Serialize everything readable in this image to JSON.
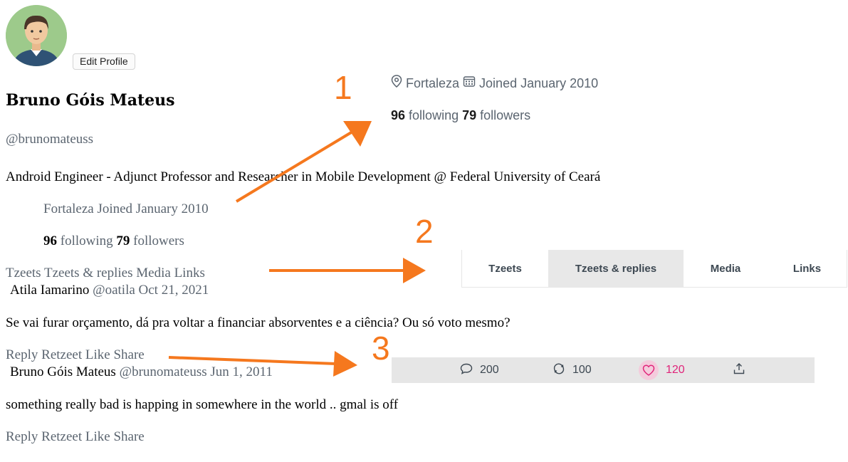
{
  "profile": {
    "edit_button": "Edit Profile",
    "name": "Bruno Góis Mateus",
    "handle": "@brunomateuss",
    "bio": "Android Engineer - Adjunct Professor and Researcher in Mobile Development @ Federal University of Ceará",
    "location": "Fortaleza",
    "joined": "Joined January 2010",
    "following_count": "96",
    "following_label": "following",
    "followers_count": "79",
    "followers_label": "followers"
  },
  "tabs": [
    "Tzeets",
    "Tzeets & replies",
    "Media",
    "Links"
  ],
  "active_tab": "Tzeets & replies",
  "tweets": [
    {
      "author": "Atila Iamarino",
      "handle": "@oatila",
      "date": "Oct 21, 2021",
      "text": "Se vai furar orçamento, dá pra voltar a financiar absorventes e a ciência? Ou só voto mesmo?",
      "actions": [
        "Reply",
        "Retzeet",
        "Like",
        "Share"
      ]
    },
    {
      "author": "Bruno Góis Mateus",
      "handle": "@brunomateuss",
      "date": "Jun 1, 2011",
      "text": "something really bad is happing in somewhere in the world .. gmal is off",
      "actions": [
        "Reply",
        "Retzeet",
        "Like",
        "Share"
      ]
    }
  ],
  "callouts": {
    "labels": [
      "1",
      "2",
      "3"
    ],
    "color": "#f5781e",
    "panel1": {
      "location": "Fortaleza",
      "joined": "Joined January 2010",
      "following_count": "96",
      "following_label": "following",
      "followers_count": "79",
      "followers_label": "followers"
    },
    "panel2": {
      "tabs": [
        "Tzeets",
        "Tzeets & replies",
        "Media",
        "Links"
      ],
      "active": "Tzeets & replies"
    },
    "panel3": {
      "reply_count": "200",
      "retweet_count": "100",
      "like_count": "120",
      "like_color": "#e0247a",
      "icons": [
        "comment-icon",
        "retweet-icon",
        "heart-icon",
        "share-icon"
      ]
    }
  }
}
